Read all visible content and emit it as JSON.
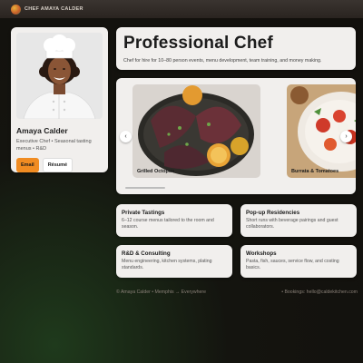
{
  "brand": {
    "name": "CHEF AMAYA CALDER"
  },
  "profile": {
    "name": "Amaya Calder",
    "role": "Executive Chef • Seasonal tasting menus • R&D",
    "email_label": "Email",
    "resume_label": "Résumé"
  },
  "hero": {
    "title": "Professional Chef",
    "subtitle": "Chef for hire for 10–80 person events, menu development, team training, and money making."
  },
  "gallery": {
    "slides": [
      {
        "caption": "Grilled Octopus"
      },
      {
        "caption": "Burrata & Tomatoes"
      }
    ],
    "prev_icon": "chevron-left-icon",
    "next_icon": "chevron-right-icon"
  },
  "services": [
    {
      "title": "Private Tastings",
      "desc": "6–12 course menus tailored to the room and season."
    },
    {
      "title": "Pop-up Residencies",
      "desc": "Short runs with beverage pairings and guest collaborators."
    },
    {
      "title": "R&D & Consulting",
      "desc": "Menu engineering, kitchen systems, plating standards."
    },
    {
      "title": "Workshops",
      "desc": "Pasta, fish, sauces, service flow, and costing basics."
    }
  ],
  "footer": {
    "left": "© Amaya Calder • Memphis → Everywhere",
    "right": "• Bookings: hello@caldekitchen.com"
  },
  "colors": {
    "accent": "#f08c22"
  }
}
